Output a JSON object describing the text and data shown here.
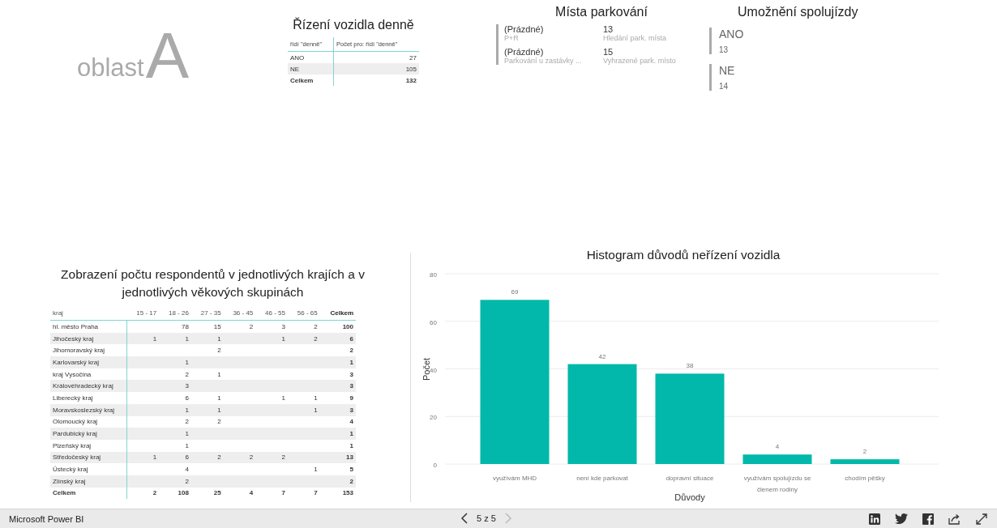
{
  "logo": {
    "prefix": "oblast",
    "letter": "A"
  },
  "driving_table": {
    "title": "Řízení vozidla denně",
    "columns": [
      "řídí \"denně\"",
      "Počet pro: řídí \"denně\""
    ],
    "rows": [
      {
        "label": "ANO",
        "value": "27"
      },
      {
        "label": "NE",
        "value": "105"
      }
    ],
    "total": {
      "label": "Celkem",
      "value": "132"
    }
  },
  "parking_card": {
    "title": "Místa parkování",
    "rows": [
      [
        {
          "value": "(Prázdné)",
          "label": "P+R"
        },
        {
          "value": "13",
          "label": "Hledání park. místa"
        }
      ],
      [
        {
          "value": "(Prázdné)",
          "label": "Parkování u zastávky ..."
        },
        {
          "value": "15",
          "label": "Vyhrazené park. místo"
        }
      ]
    ]
  },
  "carpool_card": {
    "title": "Umožnění spolujízdy",
    "items": [
      {
        "label": "ANO",
        "value": "13"
      },
      {
        "label": "NE",
        "value": "14"
      }
    ]
  },
  "region_table": {
    "title": "Zobrazení počtu respondentů v jednotlivých krajích a v jednotlivých věkových skupinách",
    "row_header": "kraj",
    "columns": [
      "15 - 17",
      "18 - 26",
      "27 - 35",
      "36 - 45",
      "46 - 55",
      "56 - 65"
    ],
    "total_column": "Celkem",
    "rows": [
      {
        "kraj": "hl. město Praha",
        "cells": [
          {
            "kind": "blank"
          },
          {
            "kind": "value",
            "text": "78"
          },
          {
            "kind": "value",
            "text": "15"
          },
          {
            "kind": "value",
            "text": "2"
          },
          {
            "kind": "value",
            "text": "3"
          },
          {
            "kind": "value",
            "text": "2"
          }
        ],
        "total": "100"
      },
      {
        "kraj": "Jihočeský kraj",
        "cells": [
          {
            "kind": "value",
            "text": "1"
          },
          {
            "kind": "value",
            "text": "1"
          },
          {
            "kind": "value",
            "text": "1"
          },
          {
            "kind": "blank"
          },
          {
            "kind": "value",
            "text": "1"
          },
          {
            "kind": "value",
            "text": "2"
          }
        ],
        "total": "6"
      },
      {
        "kraj": "Jihomoravský kraj",
        "cells": [
          {
            "kind": "blank"
          },
          {
            "kind": "blank"
          },
          {
            "kind": "value",
            "text": "2"
          },
          {
            "kind": "blank"
          },
          {
            "kind": "blank"
          },
          {
            "kind": "blank"
          }
        ],
        "total": "2"
      },
      {
        "kraj": "Karlovarský kraj",
        "cells": [
          {
            "kind": "blank"
          },
          {
            "kind": "value",
            "text": "1"
          },
          {
            "kind": "blank"
          },
          {
            "kind": "blank"
          },
          {
            "kind": "blank"
          },
          {
            "kind": "blank"
          }
        ],
        "total": "1"
      },
      {
        "kraj": "kraj Vysočina",
        "cells": [
          {
            "kind": "blank"
          },
          {
            "kind": "value",
            "text": "2"
          },
          {
            "kind": "value",
            "text": "1"
          },
          {
            "kind": "blank"
          },
          {
            "kind": "blank"
          },
          {
            "kind": "blank"
          }
        ],
        "total": "3"
      },
      {
        "kraj": "Královéhradecký kraj",
        "cells": [
          {
            "kind": "blank"
          },
          {
            "kind": "value",
            "text": "3"
          },
          {
            "kind": "blank"
          },
          {
            "kind": "blank"
          },
          {
            "kind": "blank"
          },
          {
            "kind": "blank"
          }
        ],
        "total": "3"
      },
      {
        "kraj": "Liberecký kraj",
        "cells": [
          {
            "kind": "blank"
          },
          {
            "kind": "value",
            "text": "6"
          },
          {
            "kind": "value",
            "text": "1"
          },
          {
            "kind": "blank"
          },
          {
            "kind": "value",
            "text": "1"
          },
          {
            "kind": "value",
            "text": "1"
          }
        ],
        "total": "9"
      },
      {
        "kraj": "Moravskoslezský kraj",
        "cells": [
          {
            "kind": "blank"
          },
          {
            "kind": "value",
            "text": "1"
          },
          {
            "kind": "value",
            "text": "1"
          },
          {
            "kind": "blank"
          },
          {
            "kind": "blank"
          },
          {
            "kind": "value",
            "text": "1"
          }
        ],
        "total": "3"
      },
      {
        "kraj": "Olomoucký kraj",
        "cells": [
          {
            "kind": "blank"
          },
          {
            "kind": "value",
            "text": "2"
          },
          {
            "kind": "value",
            "text": "2"
          },
          {
            "kind": "blank"
          },
          {
            "kind": "blank"
          },
          {
            "kind": "blank"
          }
        ],
        "total": "4"
      },
      {
        "kraj": "Pardubický kraj",
        "cells": [
          {
            "kind": "blank"
          },
          {
            "kind": "value",
            "text": "1"
          },
          {
            "kind": "blank"
          },
          {
            "kind": "blank"
          },
          {
            "kind": "blank"
          },
          {
            "kind": "blank"
          }
        ],
        "total": "1"
      },
      {
        "kraj": "Plzeňský kraj",
        "cells": [
          {
            "kind": "blank"
          },
          {
            "kind": "value",
            "text": "1"
          },
          {
            "kind": "blank"
          },
          {
            "kind": "blank"
          },
          {
            "kind": "blank"
          },
          {
            "kind": "blank"
          }
        ],
        "total": "1"
      },
      {
        "kraj": "Středočeský kraj",
        "cells": [
          {
            "kind": "value",
            "text": "1"
          },
          {
            "kind": "value",
            "text": "6"
          },
          {
            "kind": "value",
            "text": "2"
          },
          {
            "kind": "value",
            "text": "2"
          },
          {
            "kind": "value",
            "text": "2"
          },
          {
            "kind": "blank"
          }
        ],
        "total": "13"
      },
      {
        "kraj": "Ústecký kraj",
        "cells": [
          {
            "kind": "blank"
          },
          {
            "kind": "value",
            "text": "4"
          },
          {
            "kind": "blank"
          },
          {
            "kind": "blank"
          },
          {
            "kind": "blank"
          },
          {
            "kind": "value",
            "text": "1"
          }
        ],
        "total": "5"
      },
      {
        "kraj": "Zlínský kraj",
        "cells": [
          {
            "kind": "blank"
          },
          {
            "kind": "value",
            "text": "2"
          },
          {
            "kind": "blank"
          },
          {
            "kind": "blank"
          },
          {
            "kind": "blank"
          },
          {
            "kind": "blank"
          }
        ],
        "total": "2"
      }
    ],
    "total": {
      "kraj": "Celkem",
      "cells": [
        {
          "kind": "value",
          "text": "2"
        },
        {
          "kind": "value",
          "text": "108"
        },
        {
          "kind": "value",
          "text": "25"
        },
        {
          "kind": "value",
          "text": "4"
        },
        {
          "kind": "value",
          "text": "7"
        },
        {
          "kind": "value",
          "text": "7"
        }
      ],
      "total": "153"
    }
  },
  "histogram": {
    "chart_data": {
      "type": "bar",
      "title": "Histogram důvodů neřízení vozidla",
      "xlabel": "Důvody",
      "ylabel": "Počet",
      "categories": [
        "využívám MHD",
        "není kde parkovat",
        "dopravní situace",
        "využívám spolujízdu se členem rodiny",
        "chodím pěšky"
      ],
      "values": [
        69,
        42,
        38,
        4,
        2
      ],
      "ylim": [
        0,
        80
      ],
      "yticks": [
        0,
        20,
        40,
        60,
        80
      ],
      "grid": true,
      "data_labels": true
    }
  },
  "footer": {
    "brand": "Microsoft Power BI",
    "page": "5 z 5",
    "prev_disabled": false,
    "next_disabled": true
  }
}
